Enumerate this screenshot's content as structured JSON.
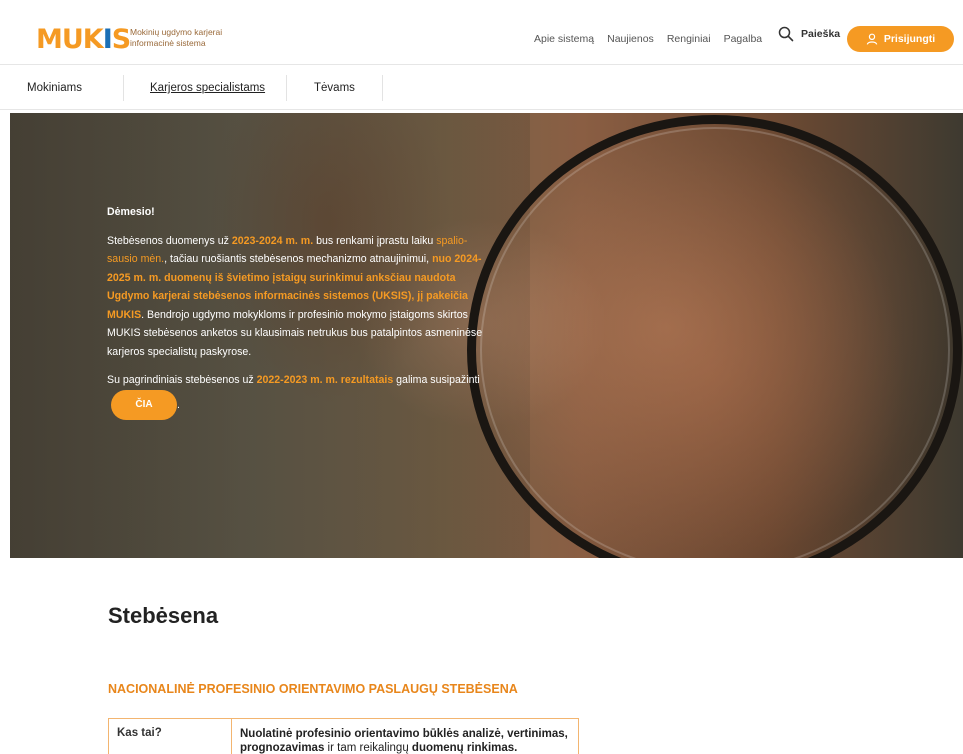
{
  "brand": {
    "logo": "MUKIS",
    "tagline": "Mokinių ugdymo karjerai informacinė sistema"
  },
  "nav": {
    "items": [
      "Apie sistemą",
      "Naujienos",
      "Renginiai",
      "Pagalba"
    ],
    "search_label": "Paieška",
    "login_label": "Prisijungti"
  },
  "subnav": {
    "tabs": [
      "Mokiniams",
      "Karjeros specialistams",
      "Tėvams"
    ],
    "active": "Karjeros specialistams"
  },
  "notice": {
    "heading": "Dėmesio!",
    "p1": {
      "t1": "Stebėsenos duomenys už ",
      "h1": "2023-2024 m. m.",
      "t2": " bus renkami įprastu laiku ",
      "h2": "spalio-sausio mėn.",
      "t3": ", tačiau ruošiantis stebėsenos mechanizmo atnaujinimui, ",
      "h3": "nuo 2024-2025 m. m. duomenų iš švietimo įstaigų surinkimui anksčiau naudota Ugdymo karjerai stebėsenos informacinės sistemos (UKSIS), jį pakeičia MUKIS",
      "t4": ". Bendrojo ugdymo mokykloms ir profesinio mokymo įstaigoms skirtos MUKIS stebėsenos anketos su klausimais netrukus bus patalpintos asmeninėse karjeros specialistų paskyrose."
    },
    "p2": {
      "t1": "Su pagrindiniais stebėsenos už ",
      "h1": "2022-2023 m. m. rezultatais",
      "t2": " galima susipažinti",
      "button": "ČIA",
      "t3": "."
    }
  },
  "section": {
    "title": "Stebėsena",
    "subtitle": "NACIONALINĖ PROFESINIO ORIENTAVIMO PASLAUGŲ STEBĖSENA"
  },
  "table": {
    "rows": [
      {
        "key": "Kas tai?",
        "v1": "Nuolatinė profesinio orientavimo būklės analizė, vertinimas, prognozavimas",
        "v2": " ir tam reikalingų ",
        "v3": "duomenų rinkimas."
      }
    ]
  },
  "colors": {
    "accent": "#f59a23",
    "brand_blue": "#1b6fb5",
    "table_border": "#f3b570"
  },
  "icons": [
    "search-icon",
    "user-icon"
  ]
}
